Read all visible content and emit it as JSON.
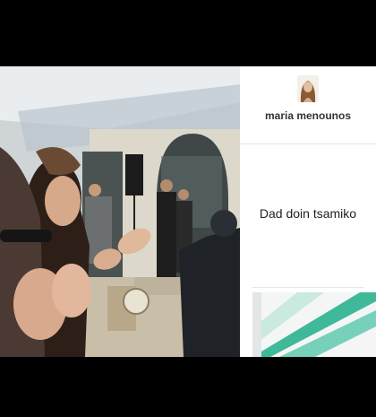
{
  "post": {
    "username": "maria menounos",
    "caption": "Dad doin tsamiko"
  },
  "icons": {
    "avatar": "profile-photo-icon"
  },
  "colors": {
    "panel_bg": "#ffffff",
    "text": "#222222",
    "thumb_accent": "#1fae8a"
  }
}
